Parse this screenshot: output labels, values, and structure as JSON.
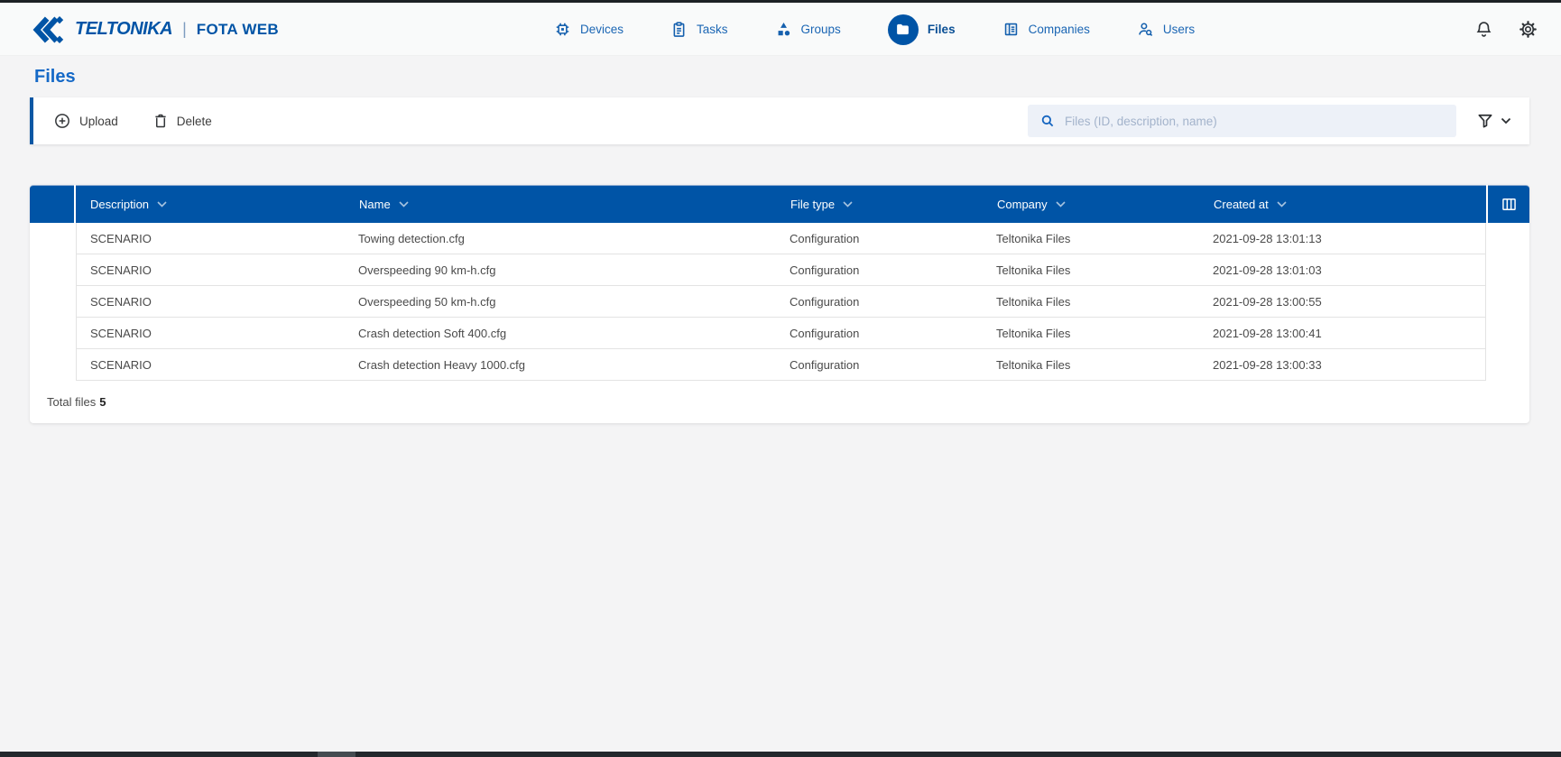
{
  "brand": {
    "name": "TELTONIKA",
    "divider": "|",
    "product": "FOTA WEB"
  },
  "nav": {
    "items": [
      {
        "label": "Devices",
        "icon": "chip-icon",
        "active": false
      },
      {
        "label": "Tasks",
        "icon": "clipboard-icon",
        "active": false
      },
      {
        "label": "Groups",
        "icon": "shapes-icon",
        "active": false
      },
      {
        "label": "Files",
        "icon": "folder-icon",
        "active": true
      },
      {
        "label": "Companies",
        "icon": "building-icon",
        "active": false
      },
      {
        "label": "Users",
        "icon": "user-search-icon",
        "active": false
      }
    ],
    "right_icons": [
      "notifications-bell-icon",
      "settings-gear-icon"
    ]
  },
  "page": {
    "title": "Files"
  },
  "toolbar": {
    "upload_label": "Upload",
    "delete_label": "Delete",
    "search_placeholder": "Files (ID, description, name)"
  },
  "table": {
    "columns": [
      "Description",
      "Name",
      "File type",
      "Company",
      "Created at"
    ],
    "rows": [
      {
        "description": "SCENARIO",
        "name": "Towing detection.cfg",
        "file_type": "Configuration",
        "company": "Teltonika Files",
        "created_at": "2021-09-28 13:01:13"
      },
      {
        "description": "SCENARIO",
        "name": "Overspeeding 90 km-h.cfg",
        "file_type": "Configuration",
        "company": "Teltonika Files",
        "created_at": "2021-09-28 13:01:03"
      },
      {
        "description": "SCENARIO",
        "name": "Overspeeding 50 km-h.cfg",
        "file_type": "Configuration",
        "company": "Teltonika Files",
        "created_at": "2021-09-28 13:00:55"
      },
      {
        "description": "SCENARIO",
        "name": "Crash detection Soft 400.cfg",
        "file_type": "Configuration",
        "company": "Teltonika Files",
        "created_at": "2021-09-28 13:00:41"
      },
      {
        "description": "SCENARIO",
        "name": "Crash detection Heavy 1000.cfg",
        "file_type": "Configuration",
        "company": "Teltonika Files",
        "created_at": "2021-09-28 13:00:33"
      }
    ],
    "footer": {
      "total_label": "Total files",
      "total_value": "5"
    }
  },
  "colors": {
    "brand_blue": "#0054a6",
    "title_blue": "#1569c7",
    "table_header_bg": "#0054a6",
    "toolbar_accent": "#0b57a4",
    "search_bg": "#edf1f8",
    "row_border": "#e3e3e3",
    "text_dark": "#4a4a4a"
  }
}
